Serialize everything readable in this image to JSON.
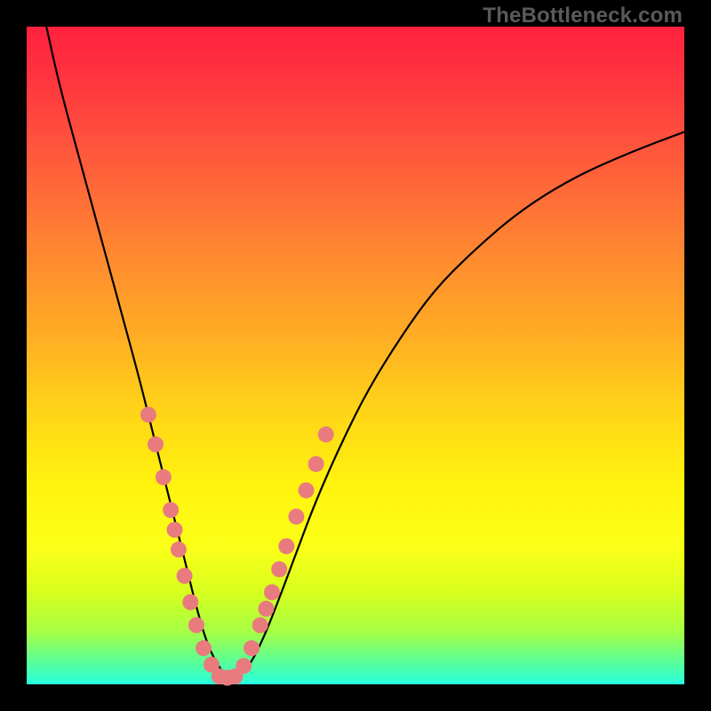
{
  "watermark": "TheBottleneck.com",
  "colors": {
    "marker": "#e97b7e",
    "curve": "#000000",
    "frame": "#000000"
  },
  "chart_data": {
    "type": "line",
    "title": "",
    "xlabel": "",
    "ylabel": "",
    "xlim": [
      0,
      100
    ],
    "ylim": [
      0,
      100
    ],
    "note": "Values estimated from pixel positions; no axis ticks visible.",
    "series": [
      {
        "name": "bottleneck-curve",
        "x": [
          3,
          5,
          8,
          11,
          14,
          17,
          19,
          21,
          23,
          24.5,
          26,
          27.5,
          29,
          30.5,
          32,
          34,
          36,
          38,
          41,
          44,
          48,
          52,
          57,
          62,
          68,
          75,
          83,
          92,
          100
        ],
        "y": [
          100,
          91,
          80,
          69,
          58,
          47,
          39,
          31,
          23,
          17,
          11,
          6,
          3,
          1,
          1,
          3,
          7,
          12,
          20,
          28,
          37,
          45,
          53,
          60,
          66,
          72,
          77,
          81,
          84
        ]
      }
    ],
    "markers": {
      "name": "highlight-points",
      "x_left": [
        18.5,
        19.6,
        20.8,
        21.9,
        22.5,
        23.1,
        24.0,
        24.9,
        25.8,
        26.9,
        28.1
      ],
      "y_left": [
        41.0,
        36.5,
        31.5,
        26.5,
        23.5,
        20.5,
        16.5,
        12.5,
        9.0,
        5.5,
        3.0
      ],
      "x_flat": [
        29.3,
        30.5,
        31.7
      ],
      "y_flat": [
        1.2,
        1.0,
        1.2
      ],
      "x_right": [
        33.0,
        34.2,
        35.5,
        36.4,
        37.3,
        38.4,
        39.5,
        41.0,
        42.5,
        44.0,
        45.5
      ],
      "y_right": [
        2.8,
        5.5,
        9.0,
        11.5,
        14.0,
        17.5,
        21.0,
        25.5,
        29.5,
        33.5,
        38.0
      ]
    }
  }
}
